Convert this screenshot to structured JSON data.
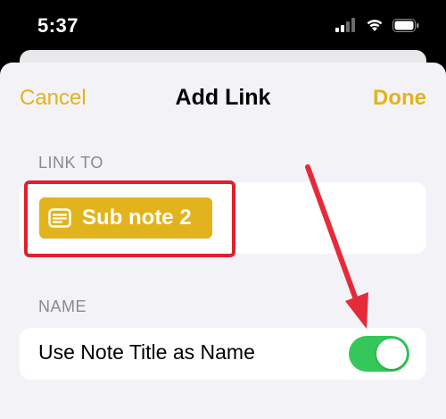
{
  "status": {
    "time": "5:37"
  },
  "nav": {
    "cancel_label": "Cancel",
    "title": "Add Link",
    "done_label": "Done"
  },
  "link_to": {
    "header": "LINK TO",
    "note_chip_label": "Sub note 2"
  },
  "name_section": {
    "header": "NAME",
    "toggle_label": "Use Note Title as Name",
    "toggle_on": true
  },
  "colors": {
    "accent": "#e2b31c",
    "toggle_on": "#35c759",
    "highlight": "#e0202c",
    "arrow": "#e52b3a"
  },
  "icons": [
    "signal-icon",
    "wifi-icon",
    "battery-icon",
    "note-icon",
    "annotation-arrow"
  ]
}
